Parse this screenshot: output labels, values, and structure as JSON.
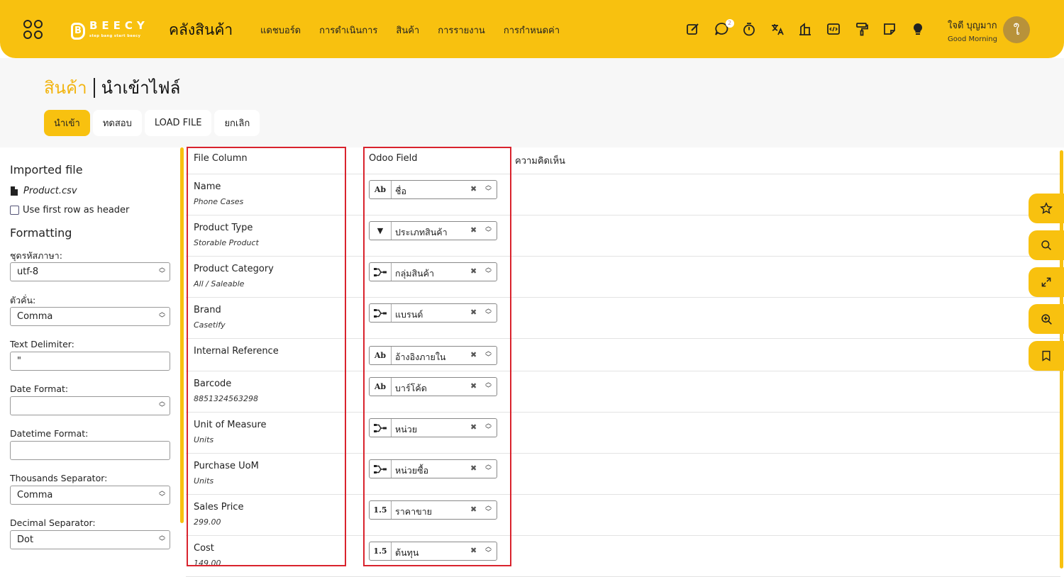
{
  "topbar": {
    "logo_text": "BEECY",
    "logo_tagline": "step bang start beecy",
    "app_title": "คลังสินค้า",
    "menu": [
      "แดชบอร์ด",
      "การดำเนินการ",
      "สินค้า",
      "การรายงาน",
      "การกำหนดค่า"
    ],
    "tool_icons": [
      "edit-icon",
      "chat-icon",
      "timer-icon",
      "translate-icon",
      "building-icon",
      "code-icon",
      "paint-roller-icon",
      "note-icon",
      "lightbulb-icon"
    ],
    "chat_badge": "2",
    "user_name": "ใจดี บุญมาก",
    "greeting": "Good Morning",
    "avatar_letter": "ใ"
  },
  "breadcrumb": {
    "parent": "สินค้า",
    "current": "นำเข้าไฟล์"
  },
  "actions": [
    "นำเข้า",
    "ทดสอบ",
    "LOAD FILE",
    "ยกเลิก"
  ],
  "sidebar": {
    "imported_file_title": "Imported file",
    "file_name": "Product.csv",
    "first_row_header_label": "Use first row as header",
    "formatting_title": "Formatting",
    "encoding_label": "ชุดรหัสภาษา:",
    "encoding_value": "utf-8",
    "separator_label": "ตัวคั่น:",
    "separator_value": "Comma",
    "text_delimiter_label": "Text Delimiter:",
    "text_delimiter_value": "\"",
    "date_format_label": "Date Format:",
    "date_format_value": "",
    "datetime_format_label": "Datetime Format:",
    "datetime_format_value": "",
    "thousands_label": "Thousands Separator:",
    "thousands_value": "Comma",
    "decimal_label": "Decimal Separator:",
    "decimal_value": "Dot"
  },
  "table": {
    "headers": {
      "file_column": "File Column",
      "odoo_field": "Odoo Field",
      "comment": "ความคิดเห็น"
    },
    "rows": [
      {
        "name": "Name",
        "sample": "Phone Cases",
        "type": "Ab",
        "field": "ชื่อ"
      },
      {
        "name": "Product Type",
        "sample": "Storable Product",
        "type": "▼",
        "field": "ประเภทสินค้า"
      },
      {
        "name": "Product Category",
        "sample": "All / Saleable",
        "type": "rel",
        "field": "กลุ่มสินค้า"
      },
      {
        "name": "Brand",
        "sample": "Casetify",
        "type": "rel",
        "field": "แบรนด์"
      },
      {
        "name": "Internal Reference",
        "sample": "",
        "type": "Ab",
        "field": "อ้างอิงภายใน"
      },
      {
        "name": "Barcode",
        "sample": "8851324563298",
        "type": "Ab",
        "field": "บาร์โค้ด"
      },
      {
        "name": "Unit of Measure",
        "sample": "Units",
        "type": "rel",
        "field": "หน่วย"
      },
      {
        "name": "Purchase UoM",
        "sample": "Units",
        "type": "rel",
        "field": "หน่วยซื้อ"
      },
      {
        "name": "Sales Price",
        "sample": "299.00",
        "type": "1.5",
        "field": "ราคาขาย"
      },
      {
        "name": "Cost",
        "sample": "149.00",
        "type": "1.5",
        "field": "ต้นทุน"
      }
    ]
  },
  "float_buttons": [
    "star-icon",
    "search-icon",
    "expand-icon",
    "zoom-in-icon",
    "bookmark-icon"
  ]
}
